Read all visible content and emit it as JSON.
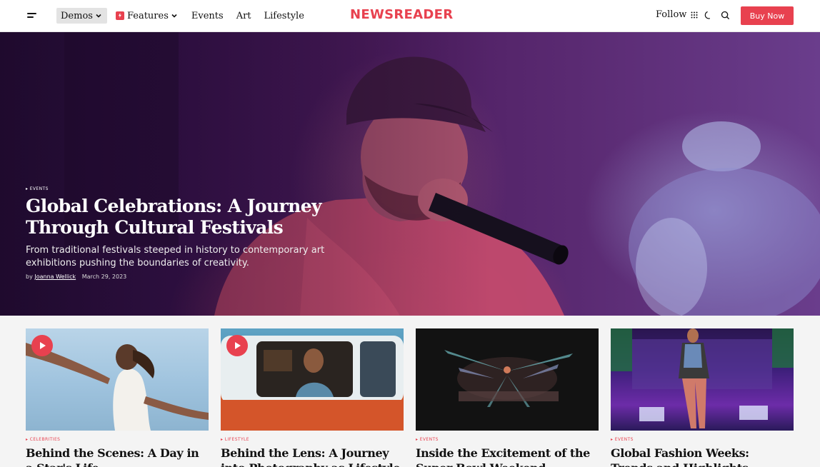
{
  "header": {
    "logo": "NEWSREADER",
    "nav": [
      {
        "label": "Demos"
      },
      {
        "label": "Features"
      },
      {
        "label": "Events"
      },
      {
        "label": "Art"
      },
      {
        "label": "Lifestyle"
      }
    ],
    "follow_label": "Follow",
    "buy_label": "Buy Now",
    "accent_color": "#e8414f"
  },
  "hero": {
    "category": "Events",
    "title": "Global Celebrations: A Journey Through Cultural Festivals",
    "subtitle": "From traditional festivals steeped in history to contemporary art exhibitions pushing the boundaries of creativity.",
    "by": "by",
    "author": "Joanna Wellick",
    "date": "March 29, 2023"
  },
  "cards": [
    {
      "category": "Celebrities",
      "title": "Behind the Scenes: A Day in a Star's Life",
      "video": true
    },
    {
      "category": "Lifestyle",
      "title": "Behind the Lens: A Journey into Photography as Lifestyle",
      "video": true
    },
    {
      "category": "Events",
      "title": "Inside the Excitement of the Super Bowl Weekend",
      "video": false
    },
    {
      "category": "Events",
      "title": "Global Fashion Weeks: Trends and Highlights",
      "video": false
    }
  ]
}
